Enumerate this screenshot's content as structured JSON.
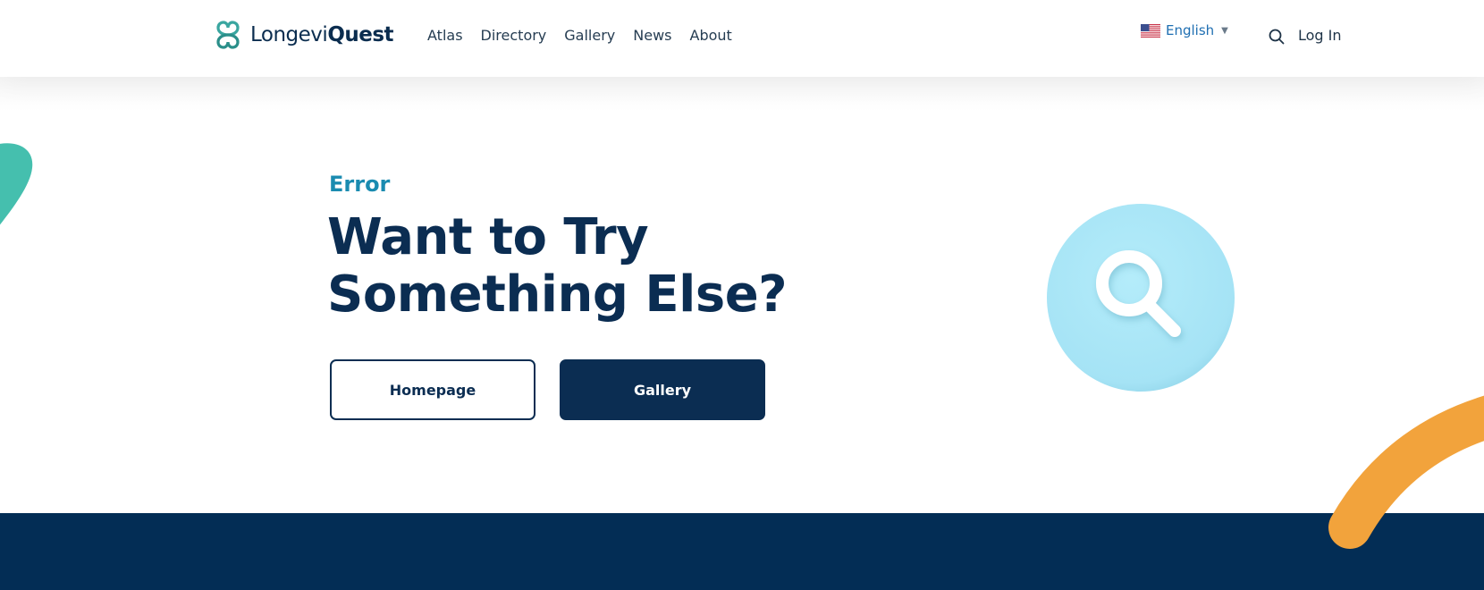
{
  "brand": {
    "name_light": "Longevi",
    "name_bold": "Quest",
    "logo_color": "#3aa6a0"
  },
  "nav": {
    "items": [
      "Atlas",
      "Directory",
      "Gallery",
      "News",
      "About"
    ]
  },
  "language": {
    "label": "English",
    "flag_icon": "us-flag-icon",
    "caret": "▼"
  },
  "header": {
    "search_icon": "search-icon",
    "login_label": "Log In"
  },
  "hero": {
    "eyebrow": "Error",
    "headline": "Want to Try Something Else?",
    "buttons": {
      "homepage": "Homepage",
      "gallery": "Gallery"
    },
    "illustration_icon": "magnifier-icon"
  },
  "colors": {
    "navy": "#0b2d52",
    "teal": "#45bfae",
    "accent_blue": "#1a8bb0",
    "orange": "#f2a33c",
    "footer": "#032d55",
    "circle": "#a8e5f6"
  }
}
